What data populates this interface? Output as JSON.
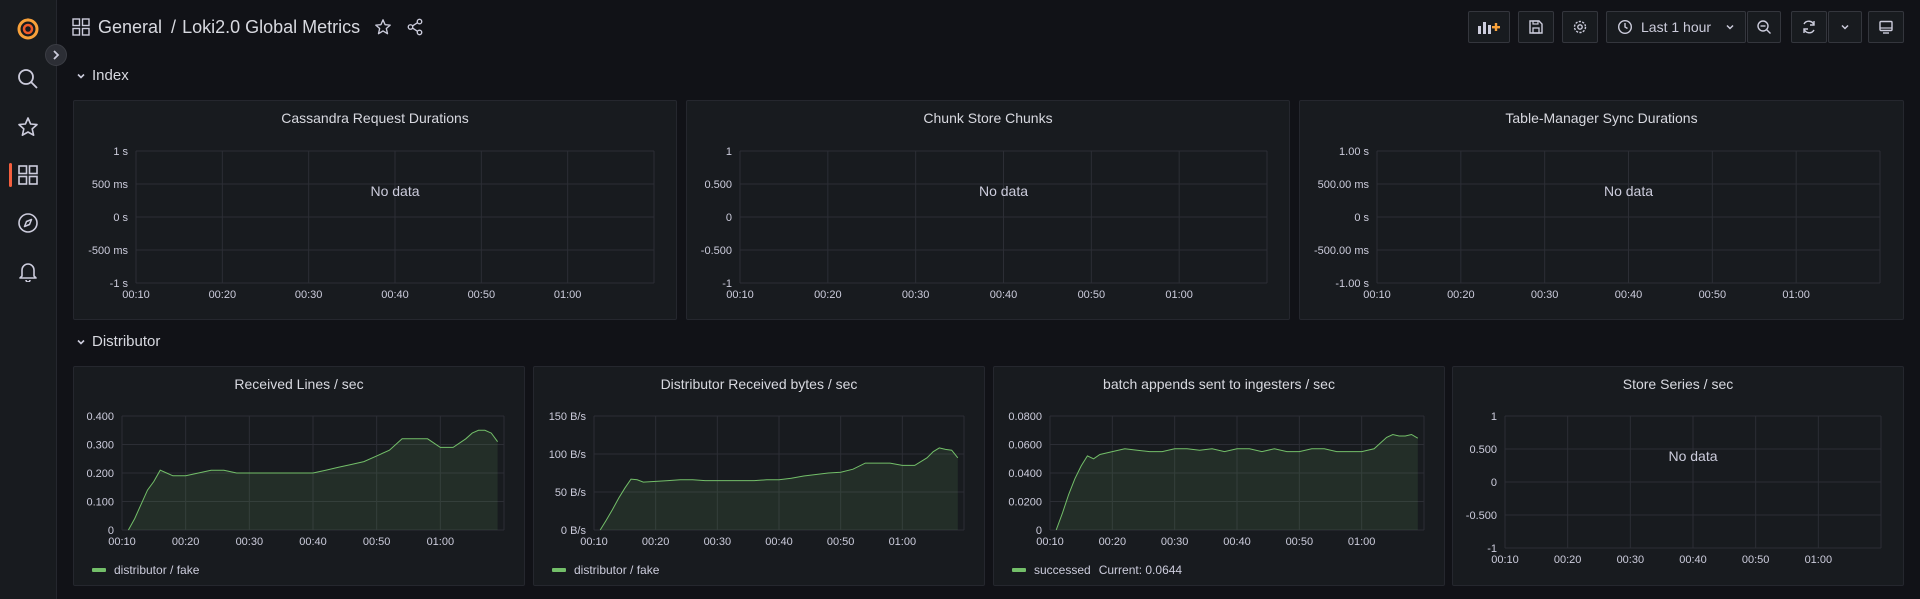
{
  "header": {
    "folder": "General",
    "separator": "/",
    "title": "Loki2.0 Global Metrics",
    "time_range": "Last 1 hour"
  },
  "sidebar": {
    "items": [
      {
        "name": "grafana-logo-icon"
      },
      {
        "name": "search-icon"
      },
      {
        "name": "starred-icon"
      },
      {
        "name": "dashboards-icon",
        "active": true
      },
      {
        "name": "explore-icon"
      },
      {
        "name": "alerting-icon"
      }
    ]
  },
  "colors": {
    "accent": "#f55f3e",
    "series": "#73bf69",
    "background": "#111217",
    "panel": "#181b1f"
  },
  "rows": [
    {
      "title": "Index"
    },
    {
      "title": "Distributor"
    }
  ],
  "panels": [
    {
      "id": "p1",
      "title": "Cassandra Request Durations",
      "no_data": "No data"
    },
    {
      "id": "p2",
      "title": "Chunk Store Chunks",
      "no_data": "No data"
    },
    {
      "id": "p3",
      "title": "Table-Manager Sync Durations",
      "no_data": "No data"
    },
    {
      "id": "p4",
      "title": "Received Lines / sec",
      "legend": "distributor / fake"
    },
    {
      "id": "p5",
      "title": "Distributor Received bytes / sec",
      "legend": "distributor / fake"
    },
    {
      "id": "p6",
      "title": "batch appends sent to ingesters / sec",
      "legend": "successed",
      "legend_extra": "Current: 0.0644"
    },
    {
      "id": "p7",
      "title": "Store Series / sec",
      "no_data": "No data"
    }
  ],
  "chart_data": [
    {
      "type": "line",
      "title": "Cassandra Request Durations",
      "x": [
        "00:10",
        "00:20",
        "00:30",
        "00:40",
        "00:50",
        "01:00"
      ],
      "y_ticks": [
        "1 s",
        "500 ms",
        "0 s",
        "-500 ms",
        "-1 s"
      ],
      "series": []
    },
    {
      "type": "line",
      "title": "Chunk Store Chunks",
      "x": [
        "00:10",
        "00:20",
        "00:30",
        "00:40",
        "00:50",
        "01:00"
      ],
      "y_ticks": [
        "1",
        "0.500",
        "0",
        "-0.500",
        "-1"
      ],
      "series": []
    },
    {
      "type": "line",
      "title": "Table-Manager Sync Durations",
      "x": [
        "00:10",
        "00:20",
        "00:30",
        "00:40",
        "00:50",
        "01:00"
      ],
      "y_ticks": [
        "1.00 s",
        "500.00 ms",
        "0 s",
        "-500.00 ms",
        "-1.00 s"
      ],
      "series": []
    },
    {
      "type": "area",
      "title": "Received Lines / sec",
      "x_ticks": [
        "00:10",
        "00:20",
        "00:30",
        "00:40",
        "00:50",
        "01:00"
      ],
      "y_ticks": [
        "0.400",
        "0.300",
        "0.200",
        "0.100",
        "0"
      ],
      "ylim": [
        0,
        0.4
      ],
      "series": [
        {
          "name": "distributor / fake",
          "x_minutes": [
            11,
            12,
            13,
            14,
            15,
            16,
            17,
            18,
            20,
            22,
            24,
            26,
            28,
            30,
            32,
            34,
            36,
            38,
            40,
            42,
            44,
            46,
            48,
            50,
            52,
            54,
            56,
            58,
            60,
            62,
            64,
            65,
            66,
            67,
            68,
            69
          ],
          "values": [
            0.0,
            0.04,
            0.09,
            0.14,
            0.17,
            0.21,
            0.2,
            0.19,
            0.19,
            0.2,
            0.21,
            0.21,
            0.2,
            0.2,
            0.2,
            0.2,
            0.2,
            0.2,
            0.2,
            0.21,
            0.22,
            0.23,
            0.24,
            0.26,
            0.28,
            0.32,
            0.32,
            0.32,
            0.29,
            0.29,
            0.32,
            0.34,
            0.35,
            0.35,
            0.34,
            0.31
          ]
        }
      ]
    },
    {
      "type": "area",
      "title": "Distributor Received bytes / sec",
      "x_ticks": [
        "00:10",
        "00:20",
        "00:30",
        "00:40",
        "00:50",
        "01:00"
      ],
      "y_ticks": [
        "150 B/s",
        "100 B/s",
        "50 B/s",
        "0 B/s"
      ],
      "ylim": [
        0,
        150
      ],
      "series": [
        {
          "name": "distributor / fake",
          "x_minutes": [
            11,
            12,
            13,
            14,
            15,
            16,
            17,
            18,
            20,
            22,
            24,
            26,
            28,
            30,
            32,
            34,
            36,
            38,
            40,
            42,
            44,
            46,
            48,
            50,
            52,
            54,
            56,
            58,
            60,
            62,
            64,
            65,
            66,
            67,
            68,
            69
          ],
          "values": [
            0,
            13,
            27,
            42,
            55,
            67,
            66,
            63,
            64,
            65,
            66,
            66,
            65,
            65,
            65,
            65,
            65,
            66,
            66,
            68,
            71,
            73,
            75,
            76,
            80,
            88,
            88,
            88,
            85,
            85,
            95,
            103,
            108,
            106,
            105,
            95
          ]
        }
      ]
    },
    {
      "type": "area",
      "title": "batch appends sent to ingesters / sec",
      "x_ticks": [
        "00:10",
        "00:20",
        "00:30",
        "00:40",
        "00:50",
        "01:00"
      ],
      "y_ticks": [
        "0.0800",
        "0.0600",
        "0.0400",
        "0.0200",
        "0"
      ],
      "ylim": [
        0,
        0.08
      ],
      "series": [
        {
          "name": "successed",
          "current": 0.0644,
          "x_minutes": [
            11,
            12,
            13,
            14,
            15,
            16,
            17,
            18,
            20,
            22,
            24,
            26,
            28,
            30,
            32,
            34,
            36,
            38,
            40,
            42,
            44,
            46,
            48,
            50,
            52,
            54,
            56,
            58,
            60,
            62,
            64,
            65,
            66,
            67,
            68,
            69
          ],
          "values": [
            0.0,
            0.012,
            0.025,
            0.036,
            0.045,
            0.052,
            0.05,
            0.053,
            0.055,
            0.057,
            0.056,
            0.055,
            0.055,
            0.057,
            0.057,
            0.056,
            0.057,
            0.055,
            0.057,
            0.057,
            0.055,
            0.057,
            0.055,
            0.055,
            0.057,
            0.057,
            0.055,
            0.055,
            0.055,
            0.057,
            0.065,
            0.067,
            0.066,
            0.066,
            0.067,
            0.0644
          ]
        }
      ]
    },
    {
      "type": "line",
      "title": "Store Series / sec",
      "x_ticks": [
        "00:10",
        "00:20",
        "00:30",
        "00:40",
        "00:50",
        "01:00"
      ],
      "y_ticks": [
        "1",
        "0.500",
        "0",
        "-0.500",
        "-1"
      ],
      "series": []
    }
  ]
}
